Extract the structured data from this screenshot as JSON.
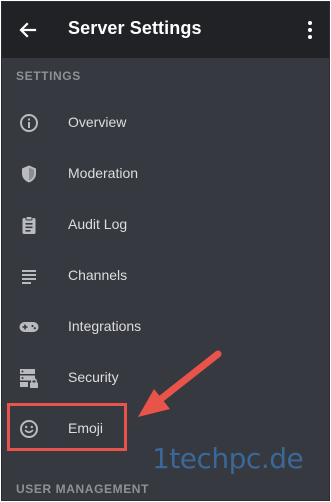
{
  "header": {
    "title": "Server Settings",
    "back_icon": "arrow-left-icon",
    "more_icon": "kebab-menu-icon"
  },
  "sections": {
    "settings_header": "SETTINGS",
    "user_management_header": "USER MANAGEMENT"
  },
  "menu": [
    {
      "label": "Overview",
      "icon": "info-circle-icon"
    },
    {
      "label": "Moderation",
      "icon": "shield-icon"
    },
    {
      "label": "Audit Log",
      "icon": "clipboard-icon"
    },
    {
      "label": "Channels",
      "icon": "list-lines-icon"
    },
    {
      "label": "Integrations",
      "icon": "gamepad-icon"
    },
    {
      "label": "Security",
      "icon": "server-lock-icon"
    },
    {
      "label": "Emoji",
      "icon": "smile-face-icon"
    }
  ],
  "annotations": {
    "highlight_color": "#e8534a",
    "watermark": "1techpc.de",
    "watermark_color": "#3b78b7"
  },
  "colors": {
    "background": "#36393f",
    "header_bg": "#202225",
    "text": "#dcddde",
    "section_text": "#8e9297"
  }
}
